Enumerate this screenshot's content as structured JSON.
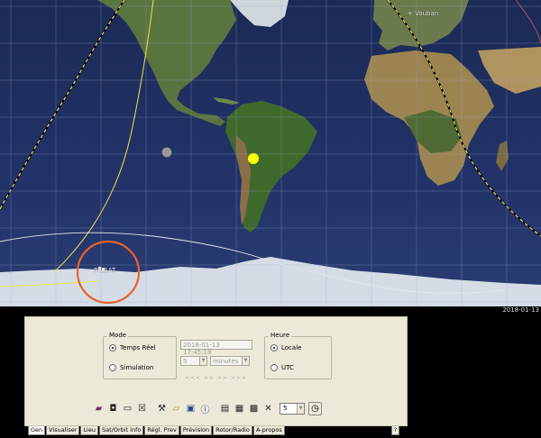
{
  "map": {
    "city_label": "+ Vouban",
    "satellite_label": "PICSAT",
    "date_corner": "2018-01-13"
  },
  "mode": {
    "legend": "Mode",
    "options": [
      "Temps Réel",
      "Simulation"
    ],
    "selected": "Temps Réel"
  },
  "simulation": {
    "datetime": "2018-01-13 17:45:18",
    "step": "5",
    "unit": "minutes",
    "nav": "<<<   <<   >>   >>>"
  },
  "heure": {
    "legend": "Heure",
    "options": [
      "Locale",
      "UTC"
    ],
    "selected": "Locale"
  },
  "toolbar": {
    "zoom_value": "5",
    "icons": [
      "book-icon",
      "camera-icon",
      "minimize-icon",
      "close-window-icon",
      "tools-icon",
      "open-folder-icon",
      "save-icon",
      "info-icon",
      "grid-option-1-icon",
      "grid-option-2-icon",
      "grid-option-3-icon",
      "fullscreen-icon",
      "clock-icon"
    ]
  },
  "tabs": [
    "Gen",
    "Visualiser",
    "Lieu",
    "Sat/Orbit info",
    "Régl. Prev",
    "Prévision",
    "Rotor/Radio",
    "A-propos"
  ],
  "active_tab": "Gen",
  "help_label": "?",
  "colors": {
    "ocean": "#1e2c58",
    "land": "#4f6b33",
    "ice": "#d5dce6",
    "sat_track": "#e8e84a",
    "terminator": "#f0e070",
    "selection_circle": "#e8632a",
    "sun": "#ffff00",
    "panel": "#ece9d8"
  }
}
